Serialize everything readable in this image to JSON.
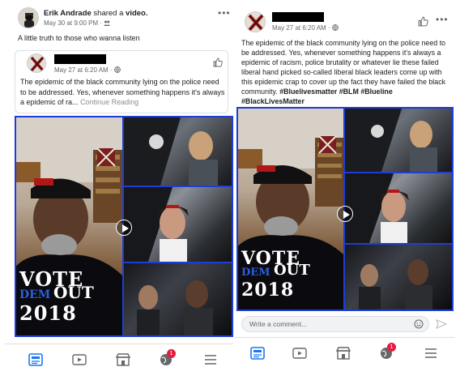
{
  "left": {
    "sharer_name": "Erik Andrade",
    "shared_phrase": "shared a",
    "shared_object": "video.",
    "timestamp": "May 30 at 9:00 PM ·",
    "caption": "A little truth to those who wanna listen",
    "shared_post": {
      "timestamp": "May 27 at 6:20 AM ·",
      "text": "The  epidemic of the black community lying on the police need to be addressed. Yes, whenever something happens it's always a epidemic of ra...",
      "continue_label": "Continue Reading"
    },
    "shirt": {
      "line1": "VOTE",
      "line2a": "DEM",
      "line2b": "OUT",
      "line3": "2018"
    },
    "nav_badge": "1"
  },
  "right": {
    "timestamp": "May 27 at 6:20 AM ·",
    "text": "The  epidemic of the black community lying on the police need to be addressed. Yes, whenever something happens it's always a epidemic of racism, police brutality or whatever lie these failed liberal hand picked so-called  liberal black leaders come up with this epidemic crap to cover up the fact they have failed the black community.",
    "hashtags": "#Bluelivesmatter #BLM #Blueline #BlackLivesMatter",
    "shirt": {
      "line1": "VOTE",
      "line2a": "DEM",
      "line2b": "OUT",
      "line3": "2018"
    },
    "comment_placeholder": "Write a comment...",
    "nav_badge": "1"
  },
  "colors": {
    "collage_border": "#1e3dd6",
    "badge": "#e41e3f",
    "meta_text": "#65676b",
    "nav_active": "#1877f2"
  },
  "icons": [
    "avatar-x",
    "more-dots-icon",
    "like-icon",
    "globe-icon",
    "friends-icon",
    "play-icon",
    "news-feed-icon",
    "watch-icon",
    "marketplace-icon",
    "notifications-globe-icon",
    "menu-icon",
    "emoji-icon",
    "send-icon"
  ]
}
